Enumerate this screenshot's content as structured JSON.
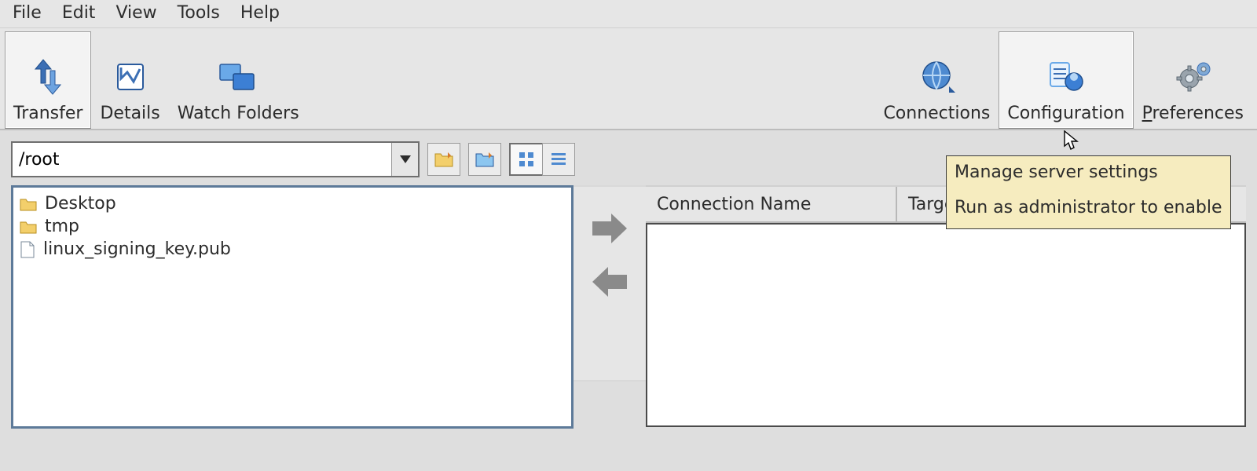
{
  "menu": {
    "file": "File",
    "edit": "Edit",
    "view": "View",
    "tools": "Tools",
    "help": "Help"
  },
  "toolbar": {
    "transfer": "Transfer",
    "details": "Details",
    "watch_folders": "Watch Folders",
    "connections": "Connections",
    "configuration": "Configuration",
    "preferences": "Preferences",
    "preferences_mnemonic_html": "P"
  },
  "path": {
    "value": "/root"
  },
  "files": [
    {
      "type": "folder",
      "name": "Desktop"
    },
    {
      "type": "folder",
      "name": "tmp"
    },
    {
      "type": "file",
      "name": "linux_signing_key.pub"
    }
  ],
  "table_headers": {
    "connection_name": "Connection Name",
    "target": "Target"
  },
  "tooltip": {
    "line1": "Manage server settings",
    "line2": "Run as administrator to enable"
  },
  "colors": {
    "bg": "#e6e6e6",
    "accent_blue": "#3c6fb4",
    "tooltip_bg": "#f6ecbf",
    "pane_border": "#5d7a99"
  }
}
